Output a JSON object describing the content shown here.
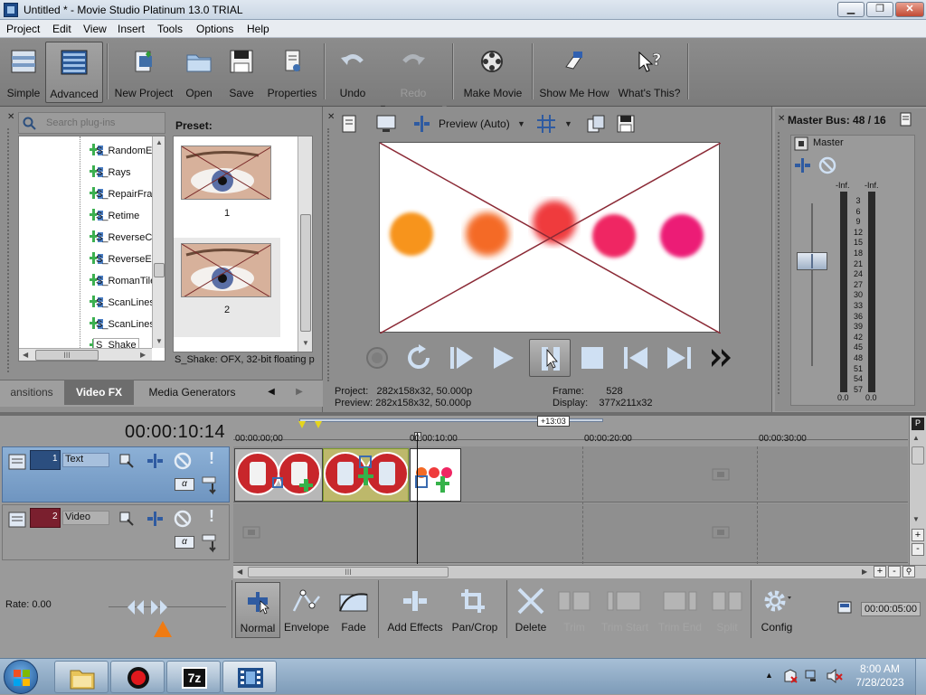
{
  "window": {
    "title": "Untitled * - Movie Studio Platinum 13.0 TRIAL",
    "min": "▁",
    "max": "❐",
    "close": "✕"
  },
  "menu": [
    "Project",
    "Edit",
    "View",
    "Insert",
    "Tools",
    "Options",
    "Help"
  ],
  "toolbar": {
    "simple": "Simple",
    "advanced": "Advanced",
    "new_project": "New Project",
    "open": "Open",
    "save": "Save",
    "properties": "Properties",
    "undo": "Undo",
    "redo": "Redo",
    "make_movie": "Make Movie",
    "show_me_how": "Show Me How",
    "whats_this": "What's This?"
  },
  "plugins": {
    "search_placeholder": "Search plug-ins",
    "items": [
      "S_RandomEd",
      "S_Rays",
      "S_RepairFran",
      "S_Retime",
      "S_ReverseCl",
      "S_ReverseEd",
      "S_RomanTile",
      "S_ScanLines",
      "S_ScanLinesI",
      "S_Shake"
    ],
    "selected": "S_Shake",
    "hscroll_grip": "III"
  },
  "presets": {
    "label": "Preset:",
    "items": [
      "1",
      "2"
    ],
    "description": "S_Shake: OFX, 32-bit floating p"
  },
  "tabs": [
    "ansitions",
    "Video FX",
    "Media Generators"
  ],
  "tab_nav": {
    "prev": "◀",
    "next": "▶"
  },
  "preview": {
    "mode": "Preview (Auto)",
    "project_label": "Project:",
    "project_value": "282x158x32, 50.000p",
    "preview_label": "Preview:",
    "preview_value": "282x158x32, 50.000p",
    "frame_label": "Frame:",
    "frame_value": "528",
    "display_label": "Display:",
    "display_value": "377x211x32",
    "dots": [
      "#f7941d",
      "#f46a25",
      "#ef3b3c",
      "#ef2663",
      "#ec1a76"
    ]
  },
  "mixer": {
    "title": "Master Bus: 48 / 16",
    "master": "Master",
    "inf_l": "-Inf.",
    "inf_r": "-Inf.",
    "ticks": [
      "3",
      "6",
      "9",
      "12",
      "15",
      "18",
      "21",
      "24",
      "27",
      "30",
      "33",
      "36",
      "39",
      "42",
      "45",
      "48",
      "51",
      "54",
      "57"
    ],
    "bottom_l": "0.0",
    "bottom_r": "0.0"
  },
  "timeline": {
    "timecode": "00:00:10:14",
    "loop_marker": "+13:03",
    "ruler": [
      "00:00:00;00",
      "00:00:10:00",
      "00:00:20:00",
      "00:00:30:00"
    ],
    "tracks": [
      {
        "number": "1",
        "name": "Text"
      },
      {
        "number": "2",
        "name": "Video"
      }
    ],
    "rate": "Rate: 0.00",
    "end_time": "00:00:05:00",
    "hscroll_grip": "III"
  },
  "edit_tools": {
    "normal": "Normal",
    "envelope": "Envelope",
    "fade": "Fade",
    "add_effects": "Add Effects",
    "pan_crop": "Pan/Crop",
    "delete": "Delete",
    "trim": "Trim",
    "trim_start": "Trim Start",
    "trim_end": "Trim End",
    "split": "Split",
    "config": "Config"
  },
  "taskbar": {
    "time": "8:00 AM",
    "date": "7/28/2023",
    "seven_zip": "7z"
  }
}
